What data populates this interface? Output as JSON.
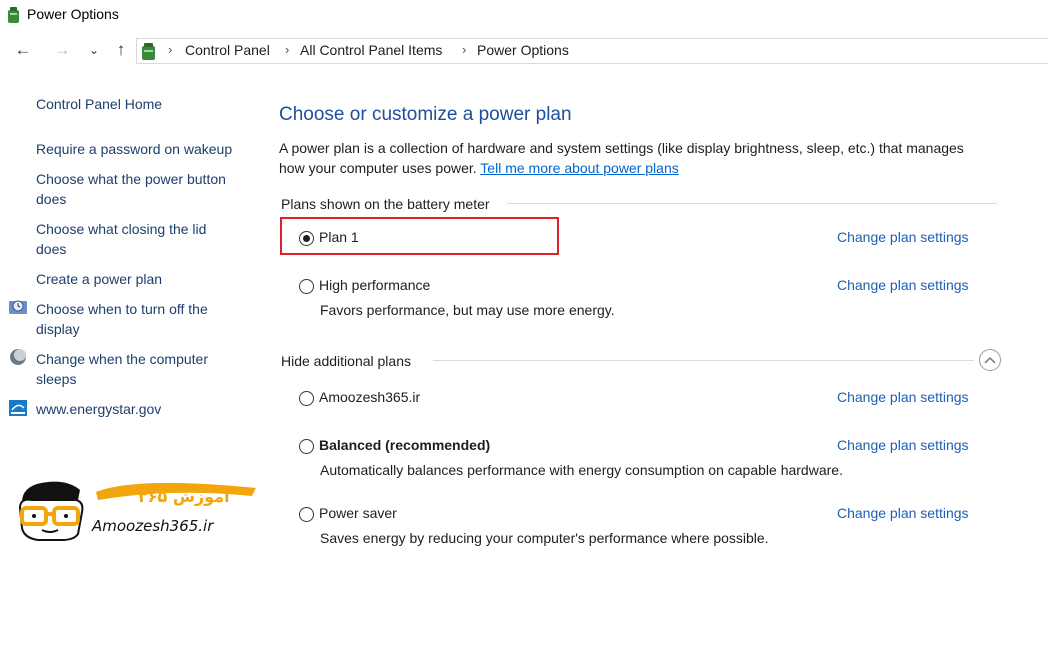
{
  "window": {
    "title": "Power Options"
  },
  "breadcrumb": [
    "Control Panel",
    "All Control Panel Items",
    "Power Options"
  ],
  "sidebar": {
    "home": "Control Panel Home",
    "links": [
      "Require a password on wakeup",
      "Choose what the power button does",
      "Choose what closing the lid does",
      "Create a power plan",
      "Choose when to turn off the display",
      "Change when the computer sleeps",
      "www.energystar.gov"
    ]
  },
  "main": {
    "heading": "Choose or customize a power plan",
    "description": "A power plan is a collection of hardware and system settings (like display brightness, sleep, etc.) that manages how your computer uses power.",
    "learn_more": "Tell me more about power plans",
    "battery_group": "Plans shown on the battery meter",
    "hidden_group": "Hide additional plans",
    "change_label": "Change plan settings",
    "plans": [
      {
        "name": "Plan 1",
        "selected": true,
        "bold": false,
        "desc": ""
      },
      {
        "name": "High performance",
        "selected": false,
        "bold": false,
        "desc": "Favors performance, but may use more energy."
      },
      {
        "name": "Amoozesh365.ir",
        "selected": false,
        "bold": false,
        "desc": ""
      },
      {
        "name": "Balanced (recommended)",
        "selected": false,
        "bold": true,
        "desc": "Automatically balances performance with energy consumption on capable hardware."
      },
      {
        "name": "Power saver",
        "selected": false,
        "bold": false,
        "desc": "Saves energy by reducing your computer's performance where possible."
      }
    ]
  },
  "logo": {
    "text": "Amoozesh365.ir",
    "lettering": "آموزش ۳۶۵"
  },
  "colors": {
    "link": "#1e5fb4",
    "heading": "#1e4f9c",
    "highlight": "#e0202a",
    "logo_accent": "#f2a60c"
  }
}
